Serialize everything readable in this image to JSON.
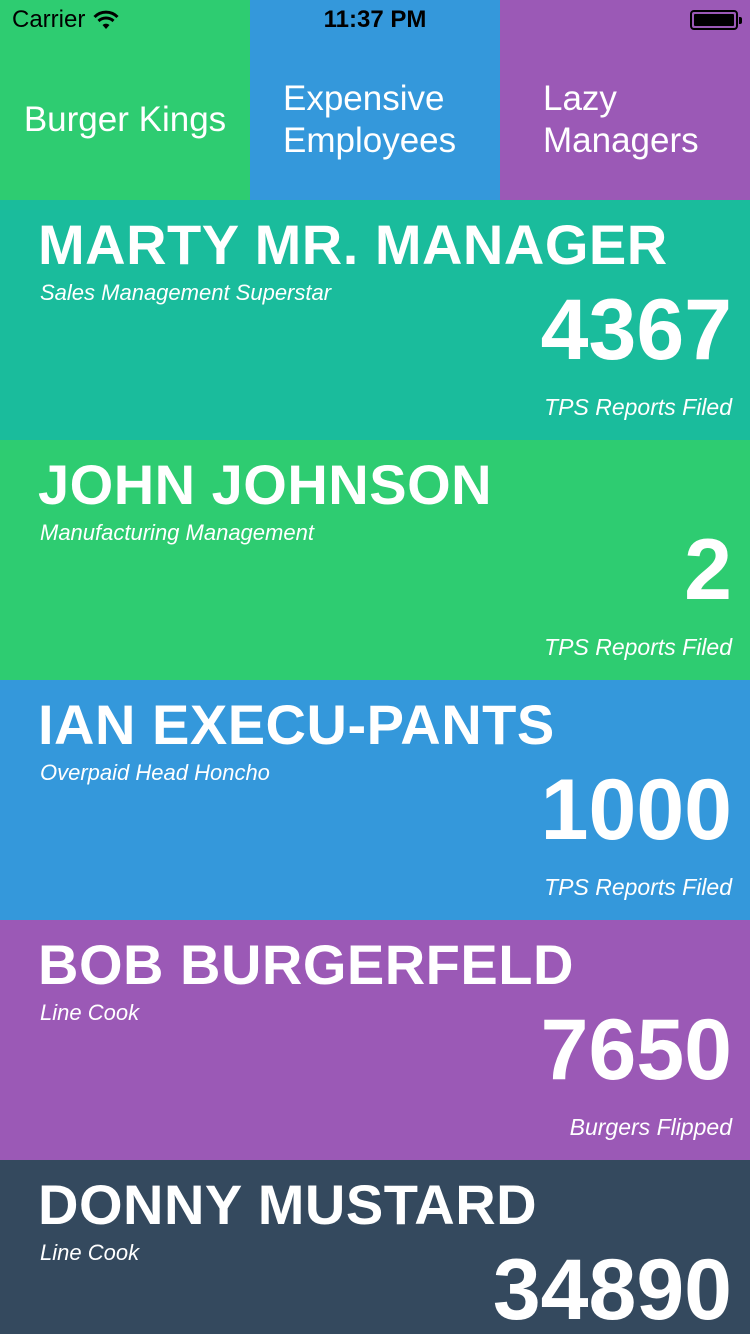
{
  "status_bar": {
    "carrier": "Carrier",
    "time": "11:37 PM",
    "icons": [
      "wifi-icon",
      "battery-icon"
    ]
  },
  "tabs": [
    {
      "lines": [
        "Burger Kings"
      ],
      "color": "#2ecc71"
    },
    {
      "lines": [
        "Expensive",
        "Employees"
      ],
      "color": "#3498db"
    },
    {
      "lines": [
        "Lazy",
        "Managers"
      ],
      "color": "#9b59b6"
    }
  ],
  "employees": [
    {
      "name": "MARTY MR. MANAGER",
      "title": "Sales Management Superstar",
      "count": "4367",
      "metric": "TPS Reports Filed",
      "color": "#1abc9c"
    },
    {
      "name": "JOHN JOHNSON",
      "title": "Manufacturing Management",
      "count": "2",
      "metric": "TPS Reports Filed",
      "color": "#2ecc71"
    },
    {
      "name": "IAN EXECU-PANTS",
      "title": "Overpaid Head Honcho",
      "count": "1000",
      "metric": "TPS Reports Filed",
      "color": "#3498db"
    },
    {
      "name": "BOB BURGERFELD",
      "title": "Line Cook",
      "count": "7650",
      "metric": "Burgers Flipped",
      "color": "#9b59b6"
    },
    {
      "name": "DONNY MUSTARD",
      "title": "Line Cook",
      "count": "34890",
      "metric": "",
      "color": "#34495e"
    }
  ]
}
